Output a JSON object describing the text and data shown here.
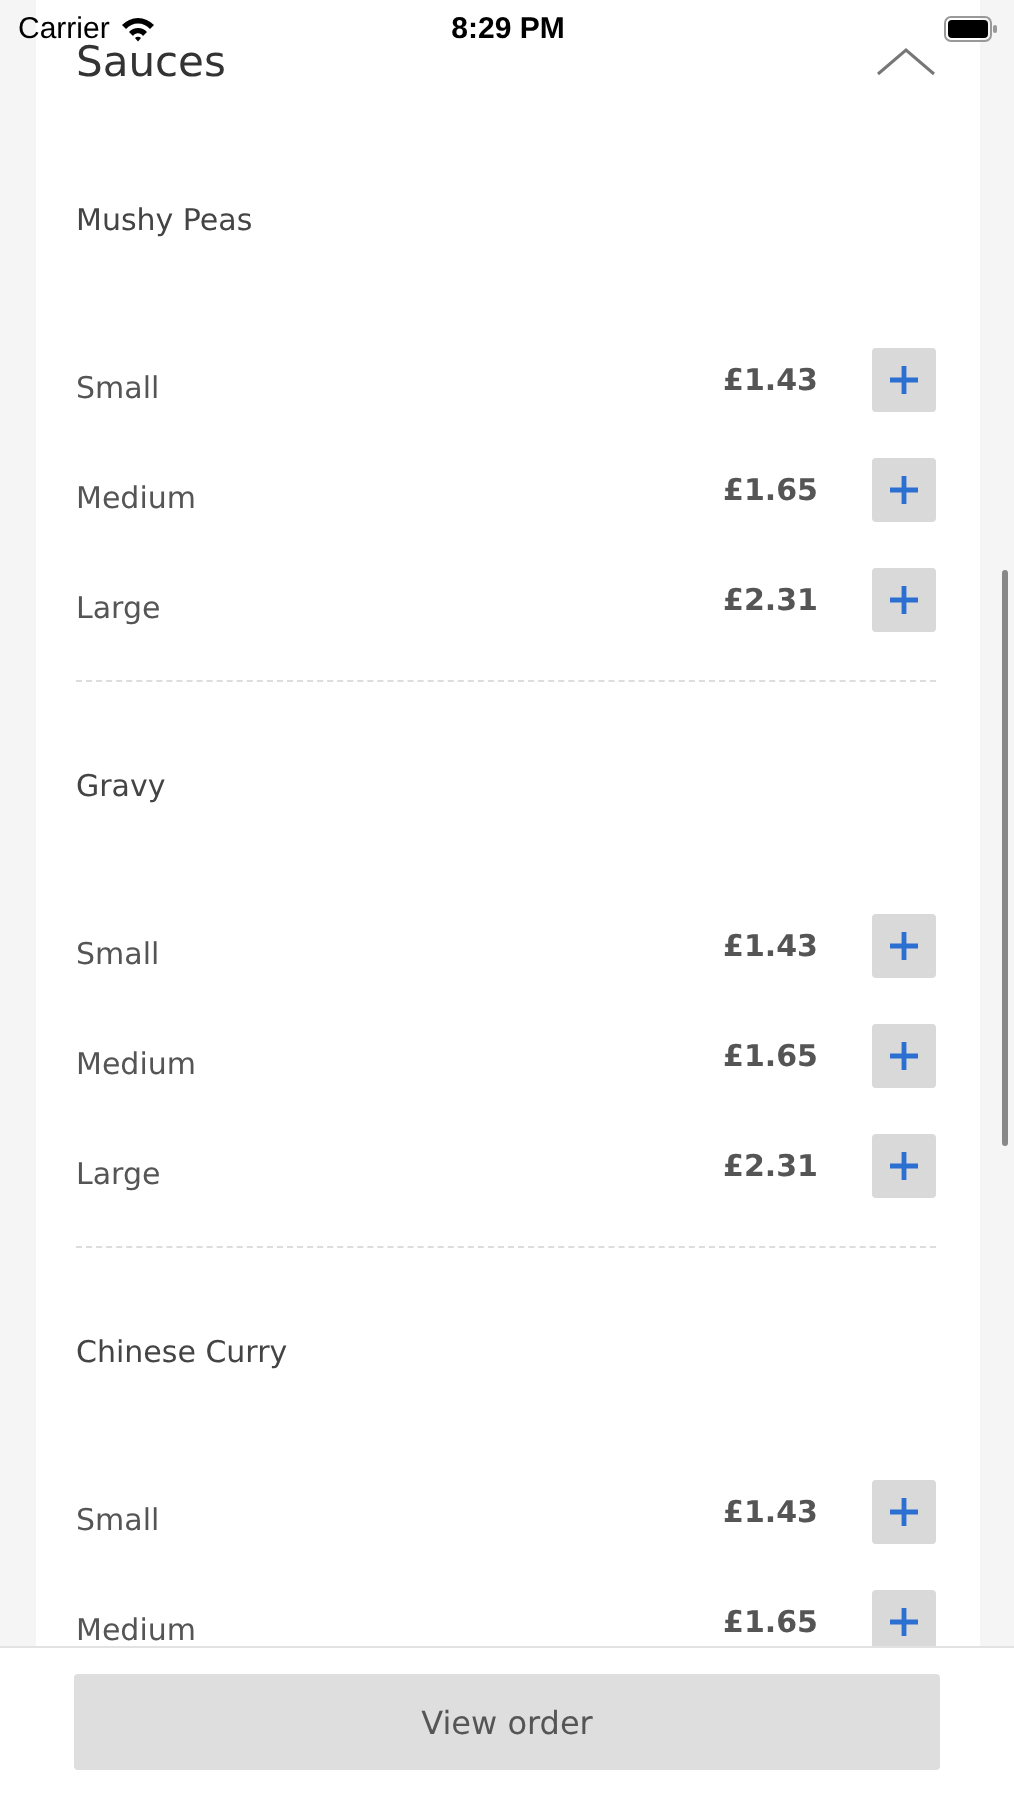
{
  "status_bar": {
    "carrier": "Carrier",
    "time": "8:29 PM"
  },
  "section": {
    "title": "Sauces",
    "expanded": true
  },
  "groups": [
    {
      "name": "Mushy Peas",
      "options": [
        {
          "size": "Small",
          "price": "£1.43"
        },
        {
          "size": "Medium",
          "price": "£1.65"
        },
        {
          "size": "Large",
          "price": "£2.31"
        }
      ]
    },
    {
      "name": "Gravy",
      "options": [
        {
          "size": "Small",
          "price": "£1.43"
        },
        {
          "size": "Medium",
          "price": "£1.65"
        },
        {
          "size": "Large",
          "price": "£2.31"
        }
      ]
    },
    {
      "name": "Chinese Curry",
      "options": [
        {
          "size": "Small",
          "price": "£1.43"
        },
        {
          "size": "Medium",
          "price": "£1.65"
        }
      ]
    }
  ],
  "footer": {
    "button": "View order"
  }
}
